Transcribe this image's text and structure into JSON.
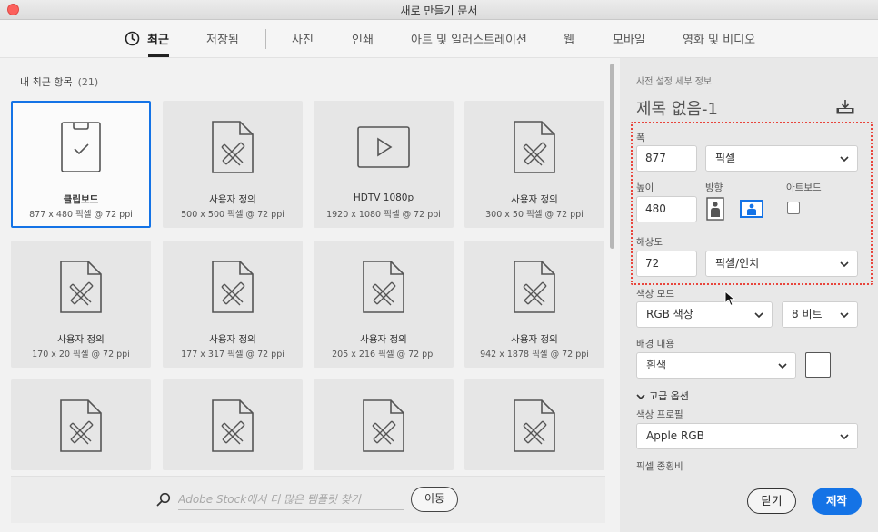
{
  "window": {
    "title": "새로 만들기 문서"
  },
  "tabs": [
    {
      "label": "최근",
      "active": true
    },
    {
      "label": "저장됨"
    },
    {
      "label": "사진"
    },
    {
      "label": "인쇄"
    },
    {
      "label": "아트 및 일러스트레이션"
    },
    {
      "label": "웹"
    },
    {
      "label": "모바일"
    },
    {
      "label": "영화 및 비디오"
    }
  ],
  "recent": {
    "title": "내 최근 항목",
    "count": "(21)",
    "items": [
      {
        "name": "클립보드",
        "size": "877 x 480 픽셀 @ 72 ppi",
        "icon": "clipboard-icon",
        "selected": true
      },
      {
        "name": "사용자 정의",
        "size": "500 x 500 픽셀 @ 72 ppi",
        "icon": "custom-document-icon"
      },
      {
        "name": "HDTV 1080p",
        "size": "1920 x 1080 픽셀 @ 72 ppi",
        "icon": "video-icon"
      },
      {
        "name": "사용자 정의",
        "size": "300 x 50 픽셀 @ 72 ppi",
        "icon": "custom-document-icon"
      },
      {
        "name": "사용자 정의",
        "size": "170 x 20 픽셀 @ 72 ppi",
        "icon": "custom-document-icon"
      },
      {
        "name": "사용자 정의",
        "size": "177 x 317 픽셀 @ 72 ppi",
        "icon": "custom-document-icon"
      },
      {
        "name": "사용자 정의",
        "size": "205 x 216 픽셀 @ 72 ppi",
        "icon": "custom-document-icon"
      },
      {
        "name": "사용자 정의",
        "size": "942 x 1878 픽셀 @ 72 ppi",
        "icon": "custom-document-icon"
      }
    ]
  },
  "search": {
    "placeholder": "Adobe Stock에서 더 많은 템플릿 찾기",
    "go_label": "이동"
  },
  "details": {
    "section_title": "사전 설정 세부 정보",
    "preset_name": "제목 없음-1",
    "width_label": "폭",
    "width_value": "877",
    "width_unit": "픽셀",
    "height_label": "높이",
    "height_value": "480",
    "orientation_label": "방향",
    "artboard_label": "아트보드",
    "resolution_label": "해상도",
    "resolution_value": "72",
    "resolution_unit": "픽셀/인치",
    "color_mode_label": "색상 모드",
    "color_mode_value": "RGB 색상",
    "bit_depth_value": "8 비트",
    "background_label": "배경 내용",
    "background_value": "흰색",
    "advanced_label": "고급 옵션",
    "color_profile_label": "색상 프로필",
    "color_profile_value": "Apple RGB",
    "pixel_aspect_label": "픽셀 종횡비",
    "close_label": "닫기",
    "create_label": "제작"
  },
  "colors": {
    "accent": "#1473e6",
    "highlight": "#e8453c"
  }
}
